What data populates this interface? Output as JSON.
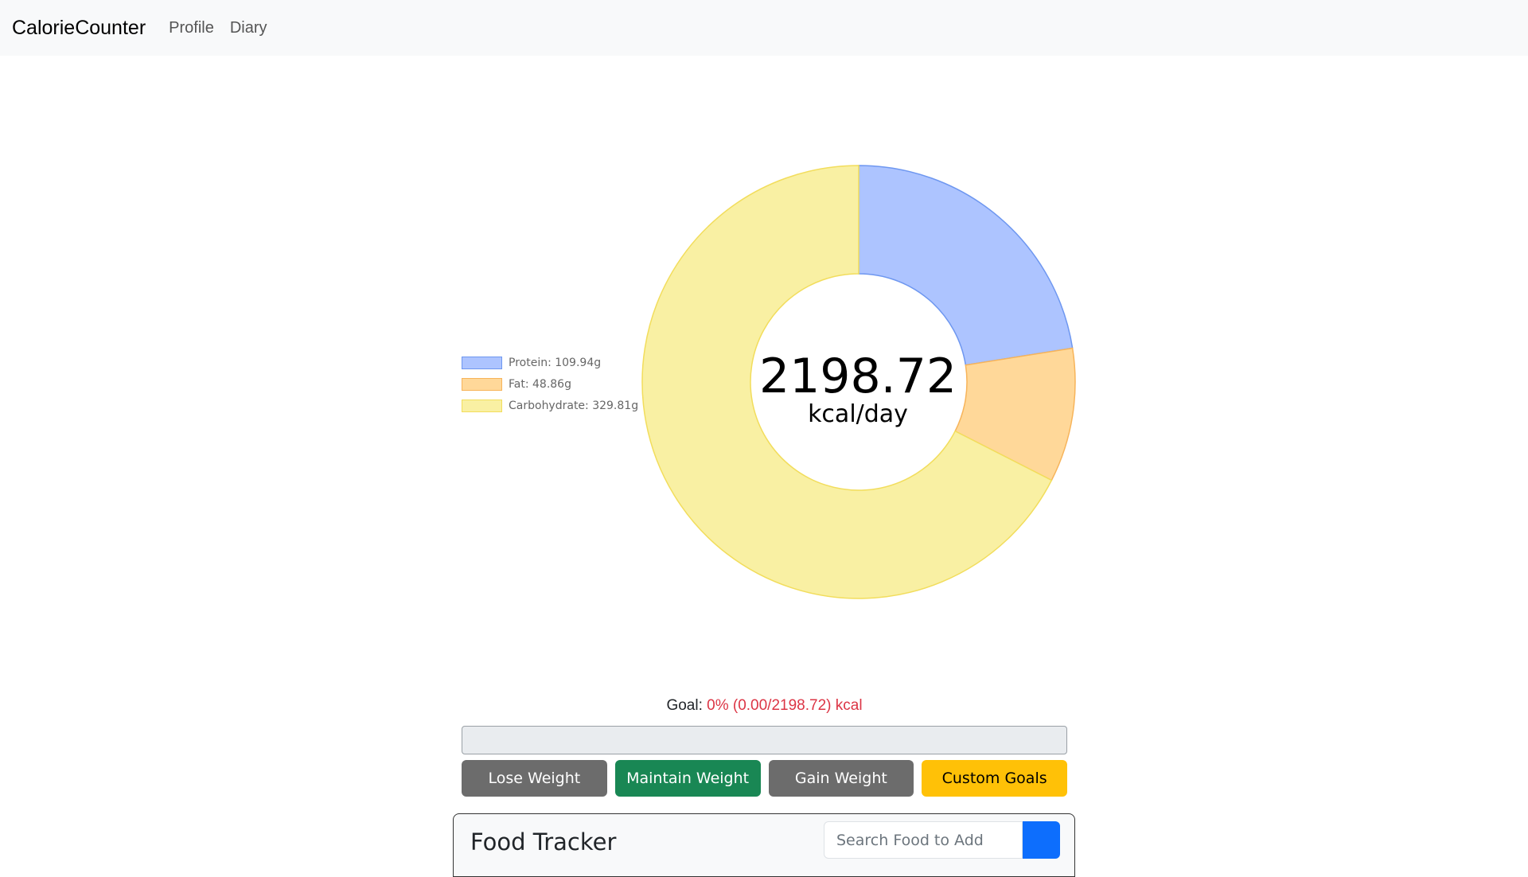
{
  "navbar": {
    "brand": "CalorieCounter",
    "links": [
      "Profile",
      "Diary"
    ]
  },
  "chart_data": {
    "type": "pie",
    "variant": "doughnut",
    "categories": [
      "Protein",
      "Fat",
      "Carbohydrate"
    ],
    "values": [
      109.94,
      48.86,
      329.81
    ],
    "units": "g",
    "legend_labels": [
      "Protein: 109.94g",
      "Fat: 48.86g",
      "Carbohydrate: 329.81g"
    ],
    "legend_placement": "left",
    "colors": {
      "fill": [
        "#adc4ff",
        "#ffd899",
        "#f9f0a3"
      ],
      "stroke": [
        "#6e97f0",
        "#f7b45a",
        "#f2dd5c"
      ]
    },
    "center_value": "2198.72",
    "center_unit": "kcal/day"
  },
  "goal": {
    "label": "Goal:",
    "status": "0% (0.00/2198.72) kcal",
    "percent": 0
  },
  "buttons": {
    "lose": "Lose Weight",
    "maintain": "Maintain Weight",
    "gain": "Gain Weight",
    "custom": "Custom Goals"
  },
  "food_tracker": {
    "title": "Food Tracker",
    "search_placeholder": "Search Food to Add",
    "search_icon": "search-icon"
  },
  "colors": {
    "danger": "#dc3545",
    "primary": "#0d6efd",
    "success": "#198754",
    "warning": "#ffc107",
    "secondary": "#6c6c6c"
  }
}
